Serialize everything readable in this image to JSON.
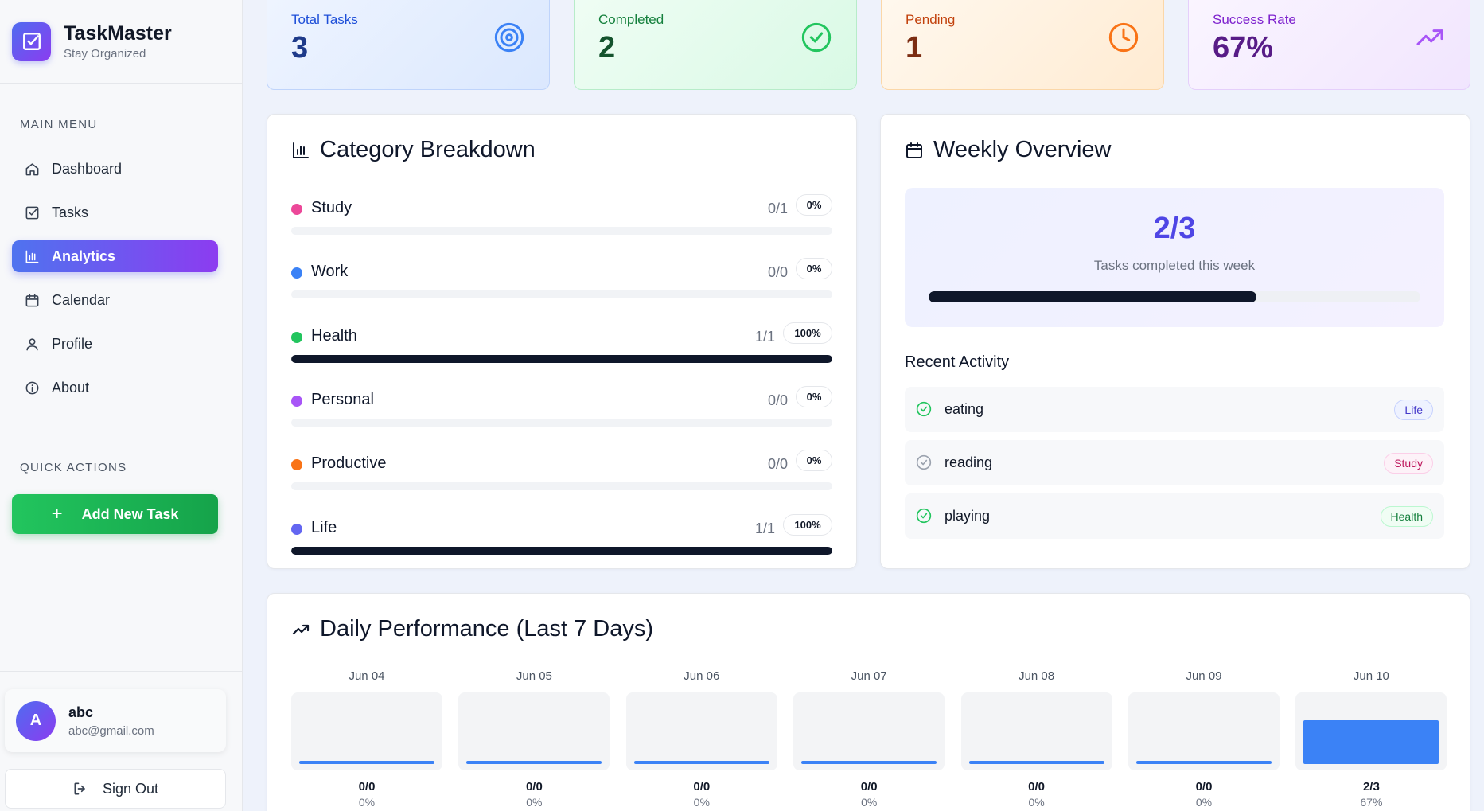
{
  "brand": {
    "name": "TaskMaster",
    "tagline": "Stay Organized"
  },
  "sidebar": {
    "main_menu_title": "MAIN MENU",
    "items": [
      {
        "label": "Dashboard",
        "icon": "home-icon"
      },
      {
        "label": "Tasks",
        "icon": "check-square-icon"
      },
      {
        "label": "Analytics",
        "icon": "bar-chart-icon",
        "active": true
      },
      {
        "label": "Calendar",
        "icon": "calendar-icon"
      },
      {
        "label": "Profile",
        "icon": "user-icon"
      },
      {
        "label": "About",
        "icon": "info-icon"
      }
    ],
    "quick_actions_title": "QUICK ACTIONS",
    "add_task_label": "Add New Task"
  },
  "user": {
    "initial": "A",
    "name": "abc",
    "email": "abc@gmail.com"
  },
  "signout_label": "Sign Out",
  "stats": {
    "total": {
      "label": "Total Tasks",
      "value": "3"
    },
    "completed": {
      "label": "Completed",
      "value": "2"
    },
    "pending": {
      "label": "Pending",
      "value": "1"
    },
    "success": {
      "label": "Success Rate",
      "value": "67%"
    }
  },
  "category_breakdown": {
    "title": "Category Breakdown",
    "categories": [
      {
        "name": "Study",
        "count": "0/1",
        "percent": "0%",
        "fill": 0,
        "color": "#ec4899"
      },
      {
        "name": "Work",
        "count": "0/0",
        "percent": "0%",
        "fill": 0,
        "color": "#3b82f6"
      },
      {
        "name": "Health",
        "count": "1/1",
        "percent": "100%",
        "fill": 1,
        "color": "#22c55e"
      },
      {
        "name": "Personal",
        "count": "0/0",
        "percent": "0%",
        "fill": 0,
        "color": "#a855f7"
      },
      {
        "name": "Productive",
        "count": "0/0",
        "percent": "0%",
        "fill": 0,
        "color": "#f97316"
      },
      {
        "name": "Life",
        "count": "1/1",
        "percent": "100%",
        "fill": 1,
        "color": "#6366f1"
      }
    ]
  },
  "weekly": {
    "title": "Weekly Overview",
    "value": "2/3",
    "caption": "Tasks completed this week",
    "progress": 0.6667,
    "recent_title": "Recent Activity",
    "activities": [
      {
        "name": "eating",
        "tag": "Life",
        "done": true
      },
      {
        "name": "reading",
        "tag": "Study",
        "done": false
      },
      {
        "name": "playing",
        "tag": "Health",
        "done": true
      }
    ]
  },
  "daily": {
    "title": "Daily Performance (Last 7 Days)",
    "days": [
      {
        "date": "Jun 04",
        "ratio": "0/0",
        "pct": "0%",
        "fill": 0
      },
      {
        "date": "Jun 05",
        "ratio": "0/0",
        "pct": "0%",
        "fill": 0
      },
      {
        "date": "Jun 06",
        "ratio": "0/0",
        "pct": "0%",
        "fill": 0
      },
      {
        "date": "Jun 07",
        "ratio": "0/0",
        "pct": "0%",
        "fill": 0
      },
      {
        "date": "Jun 08",
        "ratio": "0/0",
        "pct": "0%",
        "fill": 0
      },
      {
        "date": "Jun 09",
        "ratio": "0/0",
        "pct": "0%",
        "fill": 0
      },
      {
        "date": "Jun 10",
        "ratio": "2/3",
        "pct": "67%",
        "fill": 0.67
      }
    ]
  },
  "colors": {
    "accent": "#4f46e5",
    "progress": "#0f172a",
    "day_bar": "#3b82f6"
  }
}
